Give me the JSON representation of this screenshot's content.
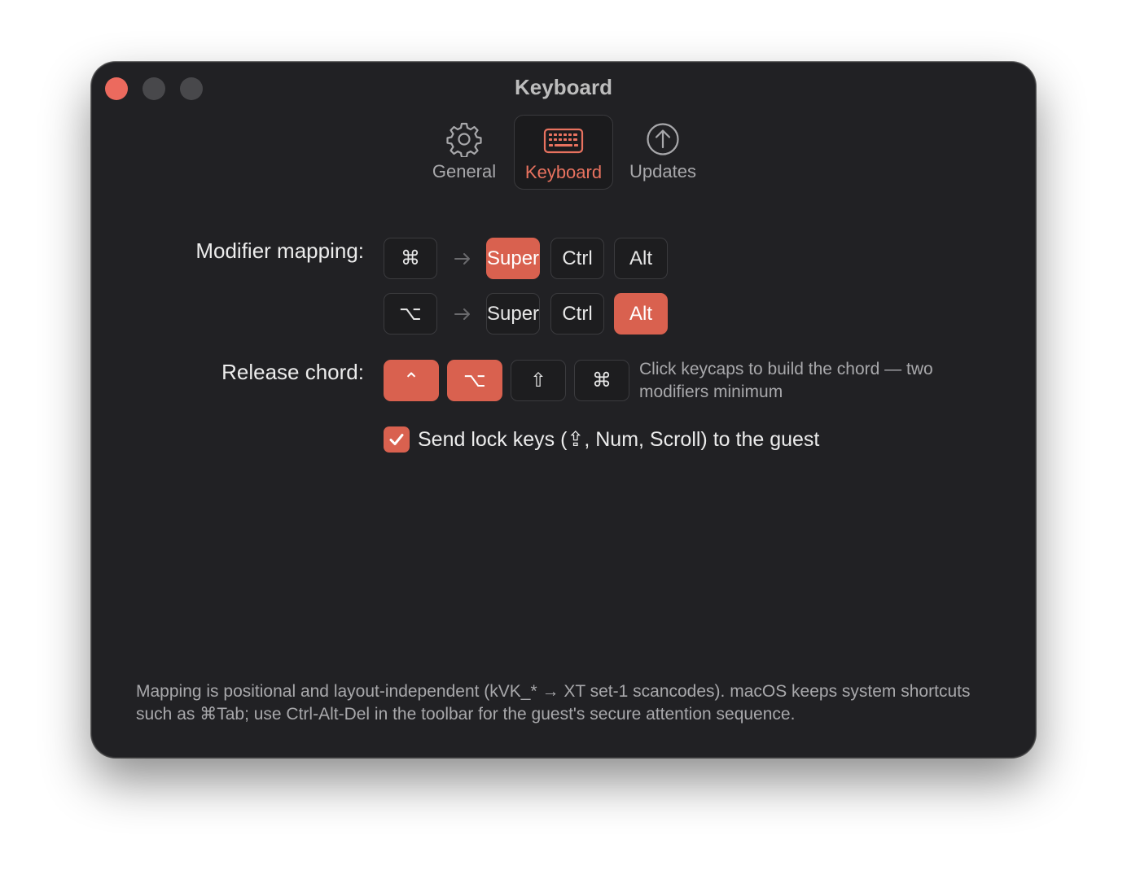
{
  "window": {
    "title": "Keyboard"
  },
  "tabs": [
    {
      "label": "General",
      "icon": "gear-icon",
      "active": false
    },
    {
      "label": "Keyboard",
      "icon": "keyboard-icon",
      "active": true
    },
    {
      "label": "Updates",
      "icon": "arrow-up-circle-icon",
      "active": false
    }
  ],
  "modifier_mapping": {
    "label": "Modifier mapping:",
    "rows": [
      {
        "source": "⌘",
        "targets": [
          "Super",
          "Ctrl",
          "Alt"
        ],
        "selected": "Super"
      },
      {
        "source": "⌥",
        "targets": [
          "Super",
          "Ctrl",
          "Alt"
        ],
        "selected": "Alt"
      }
    ]
  },
  "release_chord": {
    "label": "Release chord:",
    "keys": [
      {
        "glyph": "⌃",
        "on": true
      },
      {
        "glyph": "⌥",
        "on": true
      },
      {
        "glyph": "⇧",
        "on": false
      },
      {
        "glyph": "⌘",
        "on": false
      }
    ],
    "hint": "Click keycaps to build the chord — two modifiers minimum"
  },
  "lock_keys": {
    "checked": true,
    "label": "Send lock keys (⇪, Num, Scroll) to the guest"
  },
  "footer": "Mapping is positional and layout-independent (kVK_* → XT set-1 scancodes). macOS keeps system shortcuts such as ⌘Tab; use Ctrl-Alt-Del in the toolbar for the guest's secure attention sequence.",
  "colors": {
    "accent": "#d9614f",
    "window_bg": "#212124",
    "close_light": "#ec6a5e"
  }
}
